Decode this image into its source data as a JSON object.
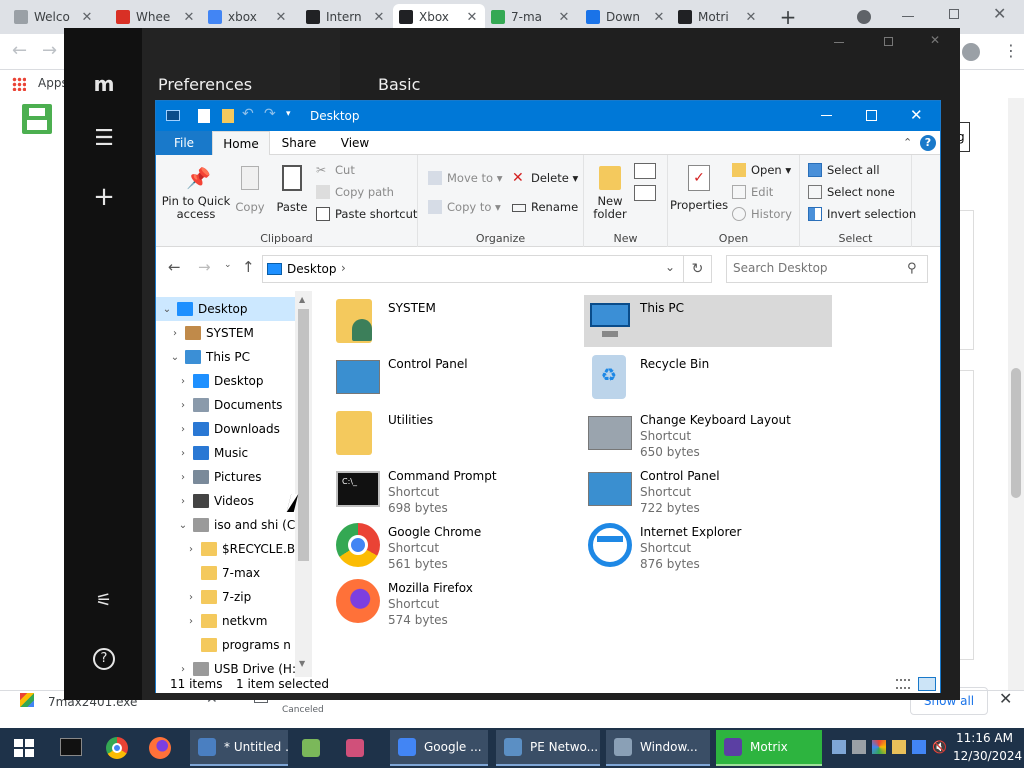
{
  "browser": {
    "tabs": [
      {
        "title": "Welco",
        "color": "#9aa0a6",
        "active": false
      },
      {
        "title": "Whee",
        "color": "#d93025",
        "active": false
      },
      {
        "title": "xbox",
        "color": "#4285f4",
        "active": false
      },
      {
        "title": "Intern",
        "color": "#202124",
        "active": false
      },
      {
        "title": "Xbox",
        "color": "#202124",
        "active": true
      },
      {
        "title": "7-ma",
        "color": "#34a853",
        "active": false
      },
      {
        "title": "Down",
        "color": "#1a73e8",
        "active": false
      },
      {
        "title": "Motri",
        "color": "#202124",
        "active": false
      }
    ],
    "new_tab": "+",
    "bookmarks_apps": "Apps",
    "download": {
      "filename": "7max2401.exe",
      "canceled": "Canceled",
      "show_all": "Show all"
    }
  },
  "motrix": {
    "preferences_title": "Preferences",
    "basic_title": "Basic"
  },
  "explorer": {
    "title": "Desktop",
    "ribbon_tabs": [
      "File",
      "Home",
      "Share",
      "View"
    ],
    "ribbon": {
      "pin_to_quick_access": "Pin to Quick access",
      "copy": "Copy",
      "paste": "Paste",
      "cut": "Cut",
      "copy_path": "Copy path",
      "paste_shortcut": "Paste shortcut",
      "clipboard": "Clipboard",
      "move_to": "Move to",
      "copy_to": "Copy to",
      "delete": "Delete",
      "rename": "Rename",
      "organize": "Organize",
      "new_folder": "New folder",
      "new": "New",
      "properties": "Properties",
      "open_btn": "Open",
      "edit": "Edit",
      "history": "History",
      "open": "Open",
      "select_all": "Select all",
      "select_none": "Select none",
      "invert_selection": "Invert selection",
      "select": "Select"
    },
    "address": "Desktop",
    "search_placeholder": "Search Desktop",
    "nav": [
      {
        "label": "Desktop",
        "indent": 0,
        "chevron": "⌄",
        "color": "#1e90ff",
        "selected": true
      },
      {
        "label": "SYSTEM",
        "indent": 1,
        "chevron": "›",
        "color": "#c08a4a",
        "selected": false
      },
      {
        "label": "This PC",
        "indent": 1,
        "chevron": "⌄",
        "color": "#3b8fd6",
        "selected": false
      },
      {
        "label": "Desktop",
        "indent": 2,
        "chevron": "›",
        "color": "#1e90ff",
        "selected": false
      },
      {
        "label": "Documents",
        "indent": 2,
        "chevron": "›",
        "color": "#8a9aab",
        "selected": false
      },
      {
        "label": "Downloads",
        "indent": 2,
        "chevron": "›",
        "color": "#2a78d4",
        "selected": false
      },
      {
        "label": "Music",
        "indent": 2,
        "chevron": "›",
        "color": "#2a78d4",
        "selected": false
      },
      {
        "label": "Pictures",
        "indent": 2,
        "chevron": "›",
        "color": "#7a8a9a",
        "selected": false
      },
      {
        "label": "Videos",
        "indent": 2,
        "chevron": "›",
        "color": "#444",
        "selected": false
      },
      {
        "label": "iso and shi (C:)",
        "indent": 2,
        "chevron": "⌄",
        "color": "#9a9a9a",
        "selected": false
      },
      {
        "label": "$RECYCLE.BIN",
        "indent": 3,
        "chevron": "›",
        "color": "#f4c95d",
        "selected": false
      },
      {
        "label": "7-max",
        "indent": 3,
        "chevron": "",
        "color": "#f4c95d",
        "selected": false
      },
      {
        "label": "7-zip",
        "indent": 3,
        "chevron": "›",
        "color": "#f4c95d",
        "selected": false
      },
      {
        "label": "netkvm",
        "indent": 3,
        "chevron": "›",
        "color": "#f4c95d",
        "selected": false
      },
      {
        "label": "programs n s",
        "indent": 3,
        "chevron": "",
        "color": "#f4c95d",
        "selected": false
      },
      {
        "label": "USB Drive (H:)",
        "indent": 2,
        "chevron": "›",
        "color": "#9a9a9a",
        "selected": false
      }
    ],
    "items": [
      {
        "name": "SYSTEM",
        "line1": "",
        "line2": "",
        "icon": "user-folder",
        "color": "#f4c95d",
        "selected": false
      },
      {
        "name": "This PC",
        "line1": "",
        "line2": "",
        "icon": "computer",
        "color": "#3b8fd6",
        "selected": true
      },
      {
        "name": "Control Panel",
        "line1": "",
        "line2": "",
        "icon": "control-panel",
        "color": "#3a8fd0",
        "selected": false
      },
      {
        "name": "Recycle Bin",
        "line1": "",
        "line2": "",
        "icon": "recycle-bin",
        "color": "#bcd4ea",
        "selected": false
      },
      {
        "name": "Utilities",
        "line1": "",
        "line2": "",
        "icon": "folder",
        "color": "#f4c95d",
        "selected": false
      },
      {
        "name": "Change Keyboard Layout",
        "line1": "Shortcut",
        "line2": "650 bytes",
        "icon": "keyboard",
        "color": "#9aa4ae",
        "selected": false
      },
      {
        "name": "Command Prompt",
        "line1": "Shortcut",
        "line2": "698 bytes",
        "icon": "terminal",
        "color": "#111111",
        "selected": false
      },
      {
        "name": "Control Panel",
        "line1": "Shortcut",
        "line2": "722 bytes",
        "icon": "control-panel",
        "color": "#3a8fd0",
        "selected": false
      },
      {
        "name": "Google Chrome",
        "line1": "Shortcut",
        "line2": "561 bytes",
        "icon": "chrome",
        "color": "#4285f4",
        "selected": false
      },
      {
        "name": "Internet Explorer",
        "line1": "Shortcut",
        "line2": "876 bytes",
        "icon": "internet-explorer",
        "color": "#1e88e5",
        "selected": false
      },
      {
        "name": "Mozilla Firefox",
        "line1": "Shortcut",
        "line2": "574 bytes",
        "icon": "firefox",
        "color": "#e8601c",
        "selected": false
      }
    ],
    "status": {
      "count": "11 items",
      "selected": "1 item selected"
    }
  },
  "taskbar": {
    "items": [
      {
        "label": "* Untitled ...",
        "color": "#4a7fc1"
      },
      {
        "label": "Google ...",
        "color": "#4285f4"
      },
      {
        "label": "PE Netwo...",
        "color": "#5b8fc4"
      },
      {
        "label": "Window...",
        "color": "#8aa0b6"
      },
      {
        "label": "Motrix",
        "color": "#5b3fa3"
      }
    ],
    "time": "11:16 AM",
    "date": "12/30/2024"
  }
}
